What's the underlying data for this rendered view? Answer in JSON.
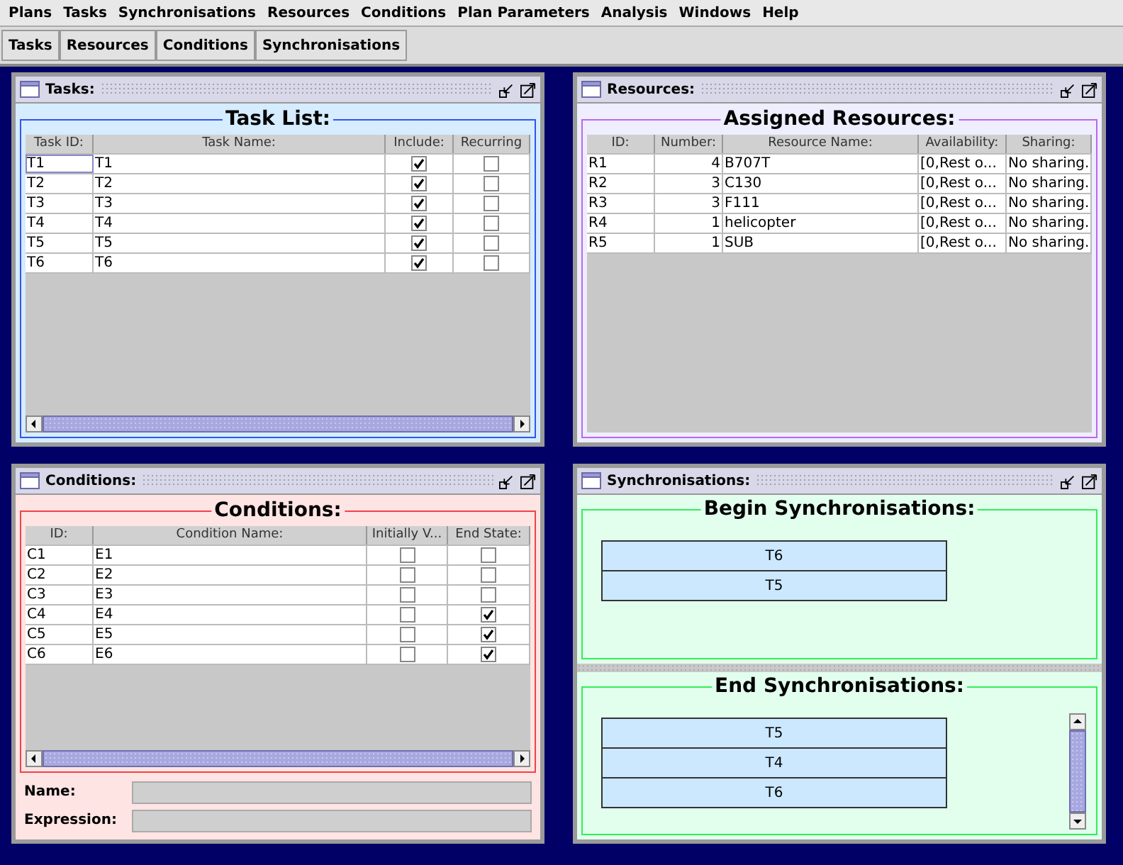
{
  "menu": [
    "Plans",
    "Tasks",
    "Synchronisations",
    "Resources",
    "Conditions",
    "Plan Parameters",
    "Analysis",
    "Windows",
    "Help"
  ],
  "toolbar": [
    "Tasks",
    "Resources",
    "Conditions",
    "Synchronisations"
  ],
  "tasks": {
    "title": "Tasks:",
    "heading": "Task List:",
    "columns": [
      "Task ID:",
      "Task Name:",
      "Include:",
      "Recurring"
    ],
    "rows": [
      {
        "id": "T1",
        "name": "T1",
        "include": true,
        "recurring": false
      },
      {
        "id": "T2",
        "name": "T2",
        "include": true,
        "recurring": false
      },
      {
        "id": "T3",
        "name": "T3",
        "include": true,
        "recurring": false
      },
      {
        "id": "T4",
        "name": "T4",
        "include": true,
        "recurring": false
      },
      {
        "id": "T5",
        "name": "T5",
        "include": true,
        "recurring": false
      },
      {
        "id": "T6",
        "name": "T6",
        "include": true,
        "recurring": false
      }
    ]
  },
  "resources": {
    "title": "Resources:",
    "heading": "Assigned Resources:",
    "columns": [
      "ID:",
      "Number:",
      "Resource Name:",
      "Availability:",
      "Sharing:"
    ],
    "rows": [
      {
        "id": "R1",
        "number": "4",
        "name": "B707T",
        "availability": "[0,Rest o...",
        "sharing": "No sharing."
      },
      {
        "id": "R2",
        "number": "3",
        "name": "C130",
        "availability": "[0,Rest o...",
        "sharing": "No sharing."
      },
      {
        "id": "R3",
        "number": "3",
        "name": "F111",
        "availability": "[0,Rest o...",
        "sharing": "No sharing."
      },
      {
        "id": "R4",
        "number": "1",
        "name": "helicopter",
        "availability": "[0,Rest o...",
        "sharing": "No sharing."
      },
      {
        "id": "R5",
        "number": "1",
        "name": "SUB",
        "availability": "[0,Rest o...",
        "sharing": "No sharing."
      }
    ]
  },
  "conditions": {
    "title": "Conditions:",
    "heading": "Conditions:",
    "columns": [
      "ID:",
      "Condition Name:",
      "Initially V...",
      "End State:"
    ],
    "rows": [
      {
        "id": "C1",
        "name": "E1",
        "initially_valid": false,
        "end_state": false
      },
      {
        "id": "C2",
        "name": "E2",
        "initially_valid": false,
        "end_state": false
      },
      {
        "id": "C3",
        "name": "E3",
        "initially_valid": false,
        "end_state": false
      },
      {
        "id": "C4",
        "name": "E4",
        "initially_valid": false,
        "end_state": true
      },
      {
        "id": "C5",
        "name": "E5",
        "initially_valid": false,
        "end_state": true
      },
      {
        "id": "C6",
        "name": "E6",
        "initially_valid": false,
        "end_state": true
      }
    ],
    "fields": [
      {
        "label": "Name:"
      },
      {
        "label": "Expression:"
      }
    ]
  },
  "synchronisations": {
    "title": "Synchronisations:",
    "begin": {
      "heading": "Begin Synchronisations:",
      "items": [
        "T6",
        "T5"
      ]
    },
    "end": {
      "heading": "End Synchronisations:",
      "items": [
        "T5",
        "T4",
        "T6"
      ]
    }
  }
}
